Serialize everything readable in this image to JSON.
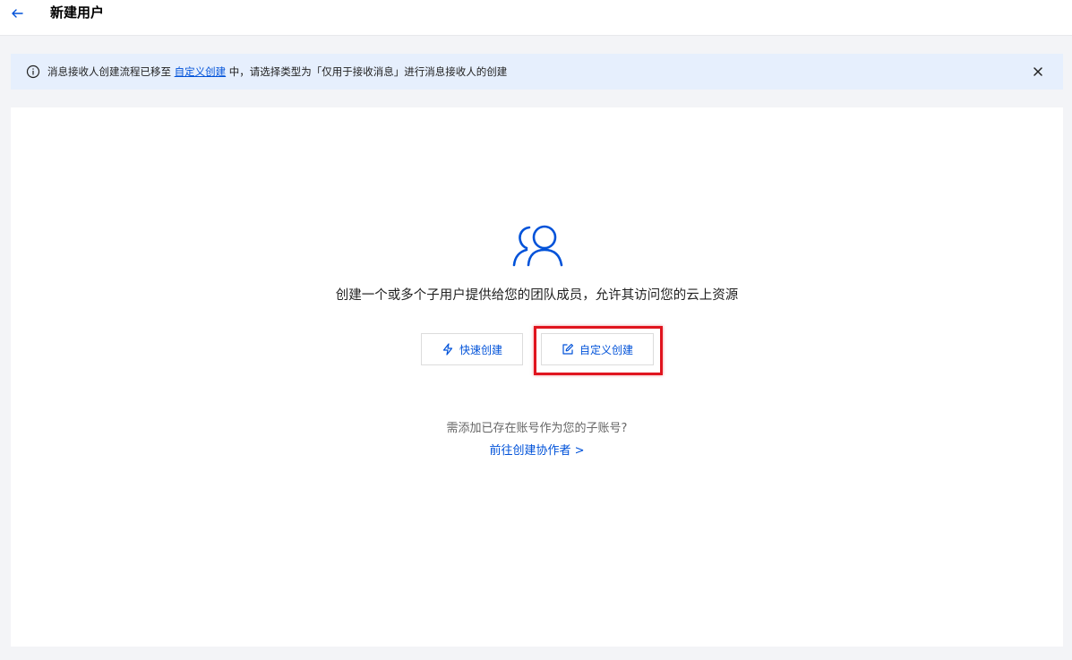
{
  "header": {
    "title": "新建用户",
    "back_icon": "arrow-left-icon"
  },
  "notice": {
    "text_before": "消息接收人创建流程已移至 ",
    "link_text": "自定义创建",
    "text_after": " 中，请选择类型为「仅用于接收消息」进行消息接收人的创建",
    "close_icon": "close-icon"
  },
  "main": {
    "icon": "users-icon",
    "description": "创建一个或多个子用户提供给您的团队成员，允许其访问您的云上资源",
    "quick_create_label": "快速创建",
    "custom_create_label": "自定义创建",
    "existing_account_question": "需添加已存在账号作为您的子账号?",
    "collaborator_link": "前往创建协作者 >"
  },
  "colors": {
    "brand_blue": "#0052d9",
    "highlight_red": "#e0141e",
    "notice_bg": "#e6effd"
  }
}
